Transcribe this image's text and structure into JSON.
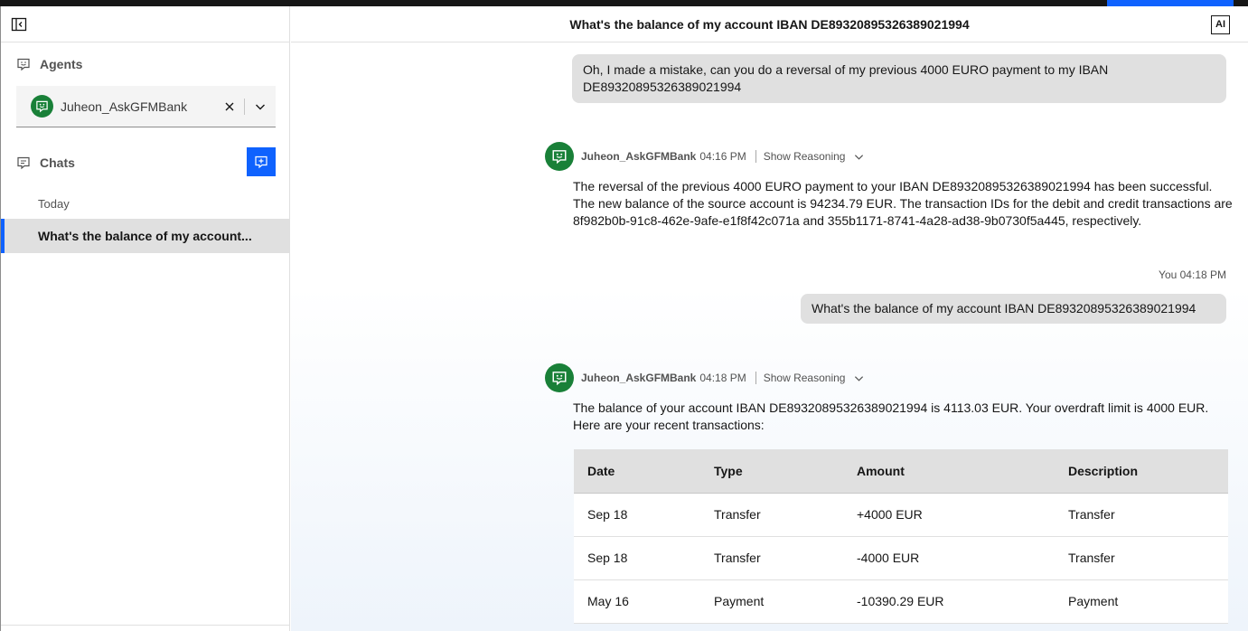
{
  "sidebar": {
    "agents_label": "Agents",
    "agent_selected": "Juheon_AskGFMBank",
    "chats_label": "Chats",
    "today_label": "Today",
    "chat_items": [
      {
        "label": "What's the balance of my account..."
      }
    ]
  },
  "header": {
    "title": "What's the balance of my account IBAN DE89320895326389021994",
    "ai_badge": "AI"
  },
  "messages": [
    {
      "role": "user",
      "text": "Oh, I made a mistake, can you do a reversal of my previous 4000 EURO payment to my IBAN DE89320895326389021994"
    },
    {
      "role": "agent",
      "name": "Juheon_AskGFMBank",
      "time": "04:16 PM",
      "reasoning_label": "Show Reasoning",
      "text": "The reversal of the previous 4000 EURO payment to your IBAN DE89320895326389021994 has been successful. The new balance of the source account is 94234.79 EUR. The transaction IDs for the debit and credit transactions are 8f982b0b-91c8-462e-9afe-e1f8f42c071a and 355b1171-8741-4a28-ad38-9b0730f5a445, respectively."
    },
    {
      "role": "user",
      "meta": "You 04:18 PM",
      "text": "What's the balance of my account IBAN DE89320895326389021994"
    },
    {
      "role": "agent",
      "name": "Juheon_AskGFMBank",
      "time": "04:18 PM",
      "reasoning_label": "Show Reasoning",
      "text": "The balance of your account IBAN DE89320895326389021994 is 4113.03 EUR. Your overdraft limit is 4000 EUR. Here are your recent transactions:"
    }
  ],
  "transactions": {
    "headers": [
      "Date",
      "Type",
      "Amount",
      "Description"
    ],
    "rows": [
      [
        "Sep 18",
        "Transfer",
        "+4000 EUR",
        "Transfer"
      ],
      [
        "Sep 18",
        "Transfer",
        "-4000 EUR",
        "Transfer"
      ],
      [
        "May 16",
        "Payment",
        "-10390.29 EUR",
        "Payment"
      ]
    ]
  },
  "colors": {
    "accent": "#0f62fe",
    "agent_avatar": "#198038",
    "bubble": "#e0e0e0"
  }
}
